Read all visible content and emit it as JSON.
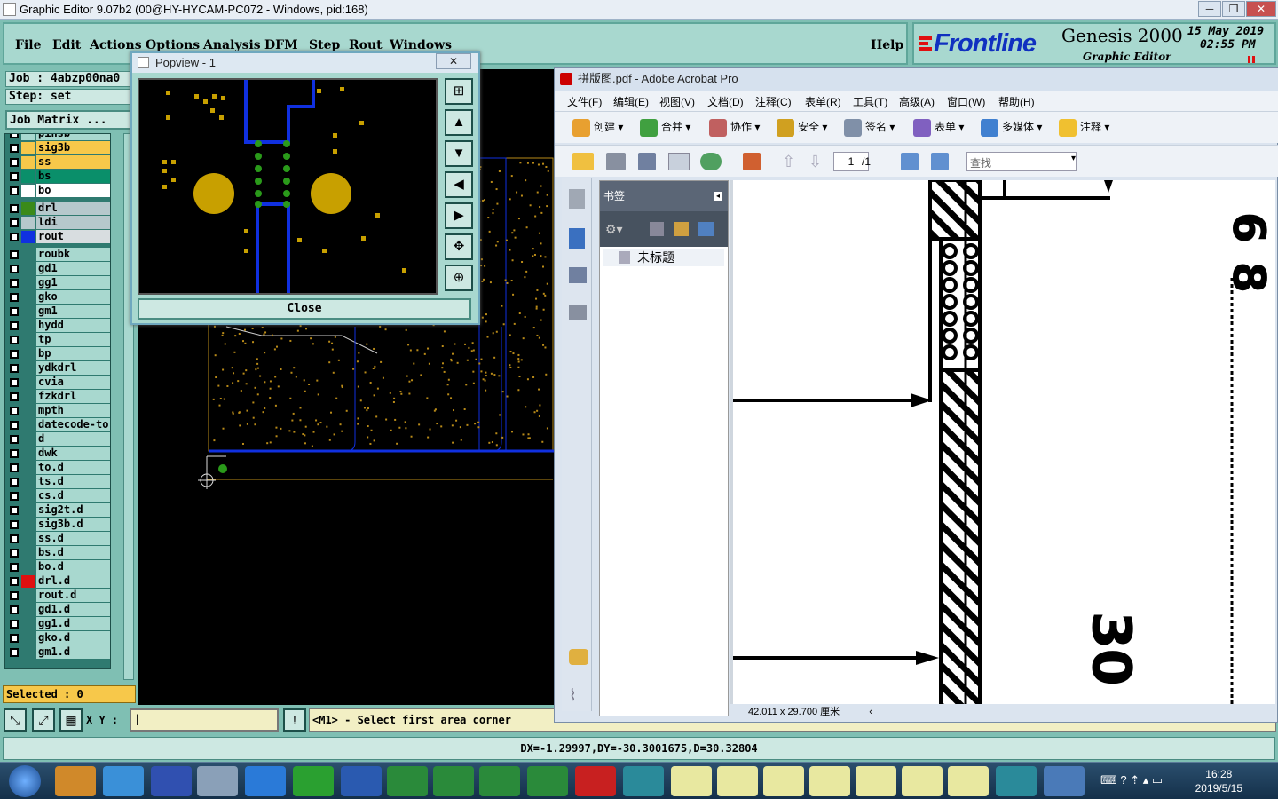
{
  "genesis": {
    "title": "Graphic Editor 9.07b2 (00@HY-HYCAM-PC072 - Windows, pid:168)",
    "menu": [
      "File",
      "Edit",
      "Actions",
      "Options",
      "Analysis",
      "DFM",
      "Step",
      "Rout",
      "Windows"
    ],
    "help": "Help",
    "brand": "Frontline",
    "product": "Genesis 2000",
    "subtitle": "Graphic Editor",
    "date": "15 May 2019",
    "time": "02:55 PM",
    "job_label": "Job : 4abzp00na0",
    "step_label": "Step: set",
    "matrix_label": "Job Matrix ...",
    "layers": [
      {
        "name": "pinsb",
        "color": "#a8d8cf"
      },
      {
        "name": "sig3b",
        "color": "#f7c84a",
        "bg": "#f7c84a"
      },
      {
        "name": "ss",
        "color": "#f7c84a",
        "bg": "#f7c84a"
      },
      {
        "name": "bs",
        "color": "#0a8f6a",
        "bg": "#0a8f6a"
      },
      {
        "name": "bo",
        "color": "#ffffff",
        "bg": "#ffffff"
      },
      {
        "name": "drl",
        "color": "#3a8a1a",
        "bg": "#b5c8cc"
      },
      {
        "name": "ldi",
        "color": "#b5c8cc",
        "bg": "#b5c8cc"
      },
      {
        "name": "rout",
        "color": "#1030e0",
        "bg": "#d8dde0"
      },
      {
        "name": "roubk"
      },
      {
        "name": "gd1"
      },
      {
        "name": "gg1"
      },
      {
        "name": "gko"
      },
      {
        "name": "gm1"
      },
      {
        "name": "hydd"
      },
      {
        "name": "tp"
      },
      {
        "name": "bp"
      },
      {
        "name": "ydkdrl"
      },
      {
        "name": "cvia"
      },
      {
        "name": "fzkdrl"
      },
      {
        "name": "mpth"
      },
      {
        "name": "datecode-to"
      },
      {
        "name": "d"
      },
      {
        "name": "dwk"
      },
      {
        "name": "to.d"
      },
      {
        "name": "ts.d"
      },
      {
        "name": "cs.d"
      },
      {
        "name": "sig2t.d"
      },
      {
        "name": "sig3b.d"
      },
      {
        "name": "ss.d"
      },
      {
        "name": "bs.d"
      },
      {
        "name": "bo.d"
      },
      {
        "name": "drl.d",
        "color": "#e01010"
      },
      {
        "name": "rout.d"
      },
      {
        "name": "gd1.d"
      },
      {
        "name": "gg1.d"
      },
      {
        "name": "gko.d"
      },
      {
        "name": "gm1.d"
      }
    ],
    "selected": "Selected : 0",
    "xy_label": "X Y :",
    "message": "<M1> - Select first area corner",
    "status": "DX=-1.29997,DY=-30.3001675,D=30.32804"
  },
  "popview": {
    "title": "Popview - 1",
    "close": "Close"
  },
  "acrobat": {
    "title": "拼版图.pdf - Adobe Acrobat Pro",
    "menu": [
      "文件(F)",
      "编辑(E)",
      "视图(V)",
      "文档(D)",
      "注释(C)",
      "表单(R)",
      "工具(T)",
      "高级(A)",
      "窗口(W)",
      "帮助(H)"
    ],
    "toolbar": [
      "创建",
      "合并",
      "协作",
      "安全",
      "签名",
      "表单",
      "多媒体",
      "注释"
    ],
    "page_current": "1",
    "page_total": "/1",
    "search_placeholder": "查找",
    "bookmarks_title": "书签",
    "bookmark_item": "未标题",
    "page_size": "42.011 x 29.700 厘米",
    "drawing_labels": [
      "6",
      "8",
      "30"
    ]
  },
  "taskbar": {
    "time": "16:28",
    "date": "2019/5/15"
  }
}
